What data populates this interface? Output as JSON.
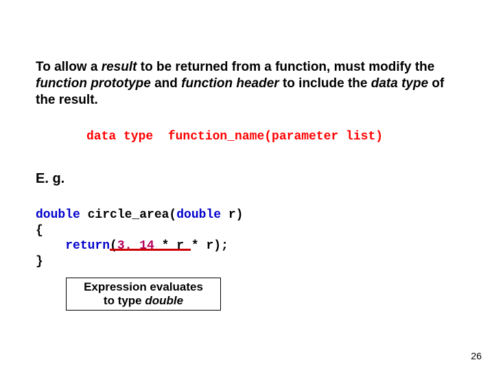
{
  "para": {
    "t1": "To allow a ",
    "t2": "result",
    "t3": " to be returned from a function, must modify the ",
    "t4": "function prototype",
    "t5": " and ",
    "t6": "function header",
    "t7": " to include the ",
    "t8": "data type",
    "t9": " of the result."
  },
  "syntax": "data type  function_name(parameter list)",
  "eg_label": "E. g.",
  "code": {
    "kw_double1": "double",
    "fn": " circle_area(",
    "kw_double2": "double",
    "param": " r)",
    "brace_open": "{",
    "indent": "    ",
    "kw_return": "return",
    "open_paren": "(",
    "lit": "3. 14",
    "rest": " * r * r);",
    "brace_close": "}"
  },
  "note": {
    "l1": "Expression evaluates",
    "l2a": "to type ",
    "l2b": "double"
  },
  "page_number": "26"
}
